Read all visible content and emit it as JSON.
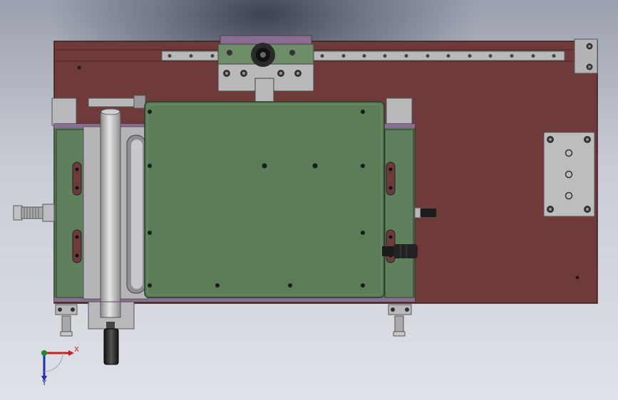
{
  "axes": {
    "x_label": "X",
    "y_label": "Y",
    "x_color": "#c8201c",
    "y_color": "#1f2fa8",
    "z_color": "#1f8a2a"
  },
  "colors": {
    "base_plate": "#6f3a3a",
    "green_panel": "#587a58",
    "green_panel_light": "#6a8c68",
    "steel": "#b9b9bb",
    "purple_trim": "#8a6d92",
    "dark_part": "#222222"
  }
}
